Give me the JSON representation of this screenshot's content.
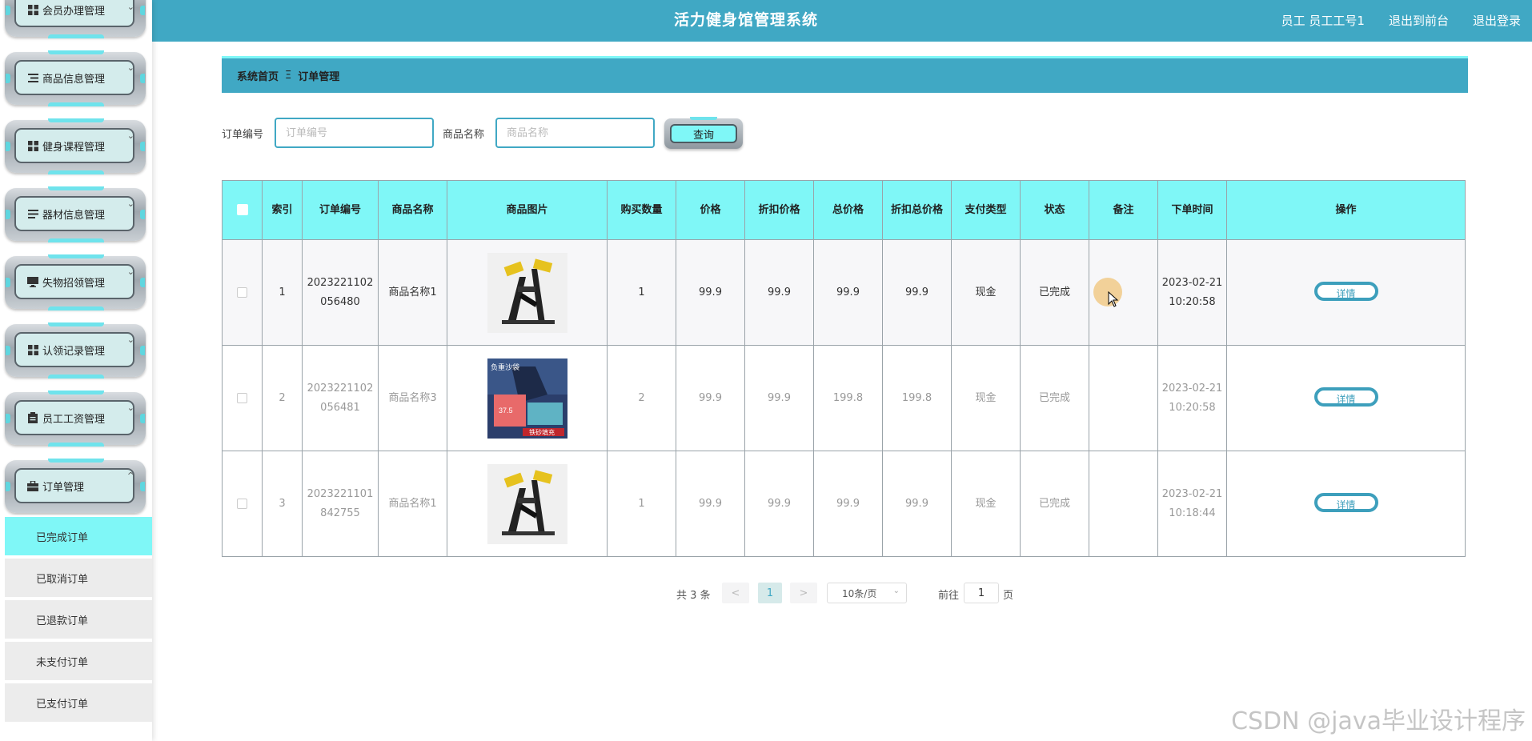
{
  "header": {
    "title": "活力健身馆管理系统",
    "user": "员工 员工工号1",
    "to_front": "退出到前台",
    "logout": "退出登录"
  },
  "sidebar": {
    "menus": [
      {
        "label": "会员办理管理",
        "icon": "grid-icon"
      },
      {
        "label": "商品信息管理",
        "icon": "list-icon"
      },
      {
        "label": "健身课程管理",
        "icon": "grid-icon"
      },
      {
        "label": "器材信息管理",
        "icon": "list-icon"
      },
      {
        "label": "失物招领管理",
        "icon": "monitor-icon"
      },
      {
        "label": "认领记录管理",
        "icon": "grid-icon"
      },
      {
        "label": "员工工资管理",
        "icon": "clipboard-icon"
      },
      {
        "label": "订单管理",
        "icon": "briefcase-icon"
      }
    ],
    "order_sub": [
      {
        "label": "已完成订单",
        "active": true
      },
      {
        "label": "已取消订单"
      },
      {
        "label": "已退款订单"
      },
      {
        "label": "未支付订单"
      },
      {
        "label": "已支付订单"
      }
    ]
  },
  "breadcrumb": {
    "home": "系统首页",
    "separator": "Ξ",
    "current": "订单管理"
  },
  "search": {
    "order_no_label": "订单编号",
    "order_no_placeholder": "订单编号",
    "product_label": "商品名称",
    "product_placeholder": "商品名称",
    "button": "查询"
  },
  "table": {
    "columns": [
      "索引",
      "订单编号",
      "商品名称",
      "商品图片",
      "购买数量",
      "价格",
      "折扣价格",
      "总价格",
      "折扣总价格",
      "支付类型",
      "状态",
      "备注",
      "下单时间",
      "操作"
    ],
    "rows": [
      {
        "index": "1",
        "order_no": "2023221102056480",
        "product": "商品名称1",
        "image": "fitness-machine-image",
        "qty": "1",
        "price": "99.9",
        "discount_price": "99.9",
        "total": "99.9",
        "discount_total": "99.9",
        "pay_type": "现金",
        "status": "已完成",
        "note": "",
        "time": "2023-02-21 10:20:58",
        "action": "详情"
      },
      {
        "index": "2",
        "order_no": "2023221102056481",
        "product": "商品名称3",
        "image": "weight-sandbag-image",
        "qty": "2",
        "price": "99.9",
        "discount_price": "99.9",
        "total": "199.8",
        "discount_total": "199.8",
        "pay_type": "现金",
        "status": "已完成",
        "note": "",
        "time": "2023-02-21 10:20:58",
        "action": "详情"
      },
      {
        "index": "3",
        "order_no": "2023221101842755",
        "product": "商品名称1",
        "image": "fitness-machine-image",
        "qty": "1",
        "price": "99.9",
        "discount_price": "99.9",
        "total": "99.9",
        "discount_total": "99.9",
        "pay_type": "现金",
        "status": "已完成",
        "note": "",
        "time": "2023-02-21 10:18:44",
        "action": "详情"
      }
    ],
    "sandbag_text": "负重沙袋",
    "sandbag_price": "37.5",
    "sandbag_tag": "铁砂填充"
  },
  "pagination": {
    "total": "共 3 条",
    "prev": "<",
    "page": "1",
    "next": ">",
    "size": "10条/页",
    "goto_label": "前往",
    "goto_value": "1",
    "page_suffix": "页"
  },
  "watermark": "CSDN @java毕业设计程序",
  "colors": {
    "header": "#40a8c4",
    "accent": "#7ff7f7",
    "button_border": "#3d9fbc"
  }
}
